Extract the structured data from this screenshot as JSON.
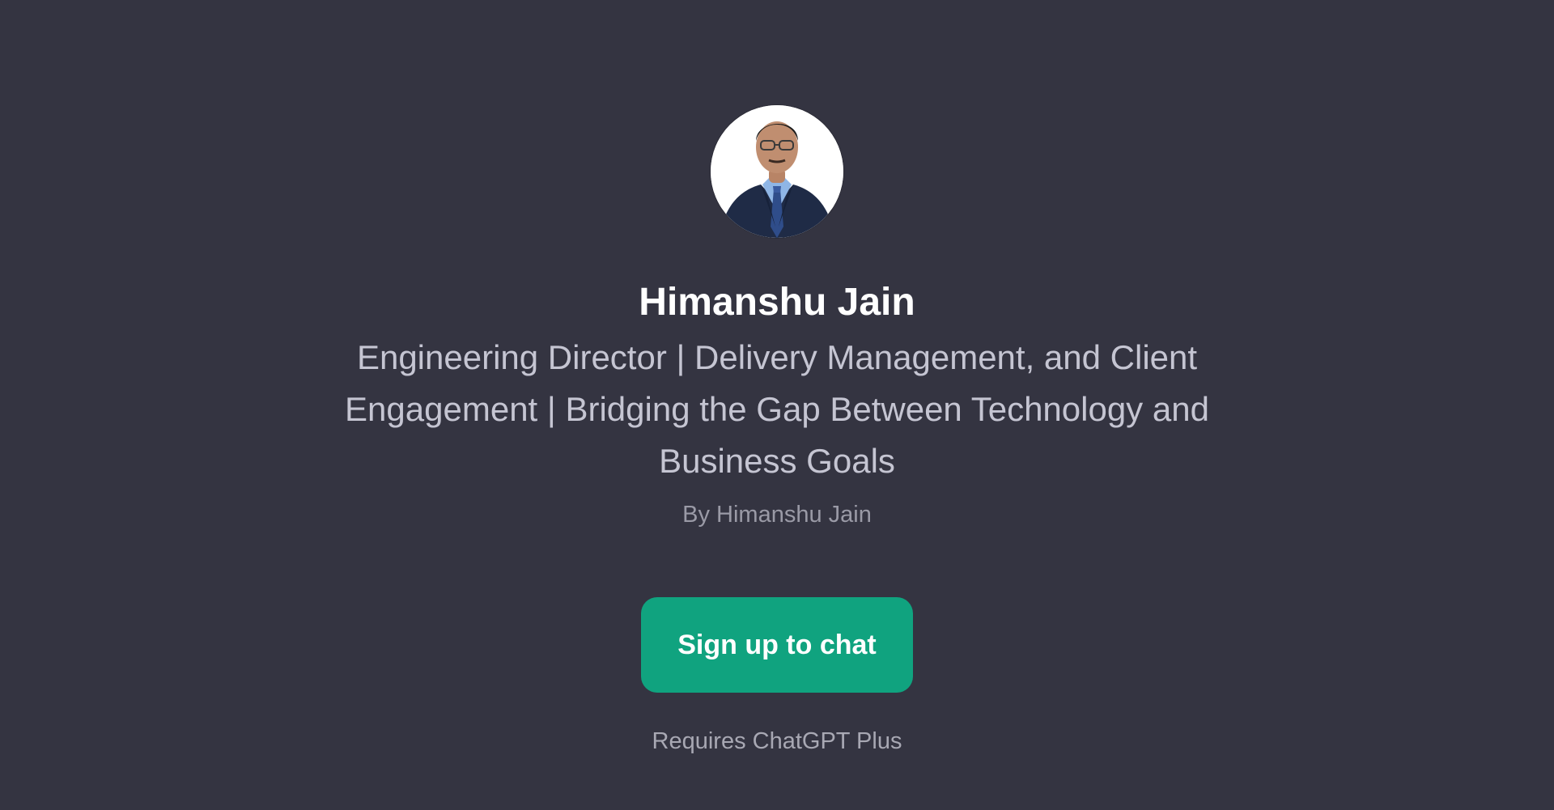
{
  "profile": {
    "name": "Himanshu Jain",
    "description": "Engineering Director | Delivery Management, and Client Engagement | Bridging the Gap Between Technology and Business Goals",
    "author": "By Himanshu Jain"
  },
  "actions": {
    "signup_label": "Sign up to chat",
    "requires_text": "Requires ChatGPT Plus"
  },
  "colors": {
    "background": "#343441",
    "button": "#10a37f",
    "title": "#ffffff",
    "description": "#c5c5d2",
    "muted": "#9a9aa6"
  }
}
